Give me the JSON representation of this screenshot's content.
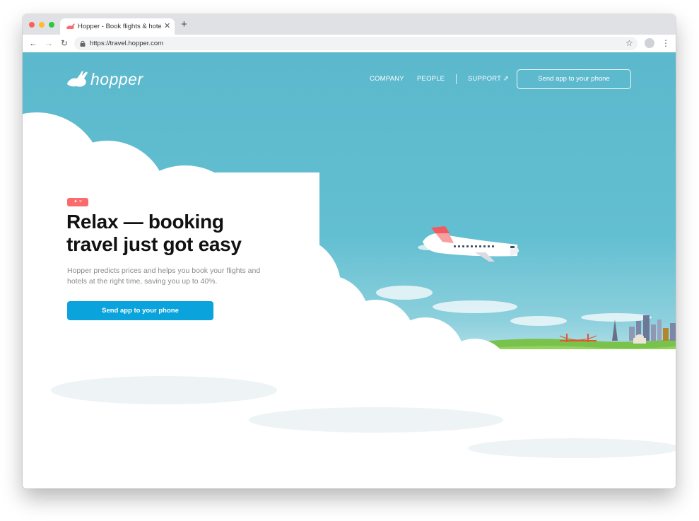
{
  "browser": {
    "tab_title": "Hopper - Book flights & hotels",
    "tab_close": "✕",
    "new_tab": "+",
    "back": "←",
    "forward": "→",
    "reload": "↻",
    "url": "https://travel.hopper.com",
    "bookmark": "☆",
    "menu": "⋮"
  },
  "header": {
    "logo_text": "hopper",
    "nav": [
      "COMPANY",
      "PEOPLE",
      "SUPPORT ⇗"
    ],
    "cta": "Send app to your phone"
  },
  "hero": {
    "badge": "✦ × ",
    "headline": "Relax — booking travel just got easy",
    "subtitle": "Hopper predicts prices and helps you book your flights and hotels at the right time, saving you up to 40%.",
    "cta": "Send app to your phone"
  },
  "colors": {
    "sky": "#5cb8cc",
    "cta": "#0aa3dc",
    "badge": "#fa6b6b"
  },
  "icons": {
    "lock": "lock-icon",
    "star": "star-icon",
    "bunny": "bunny-logo-icon"
  }
}
